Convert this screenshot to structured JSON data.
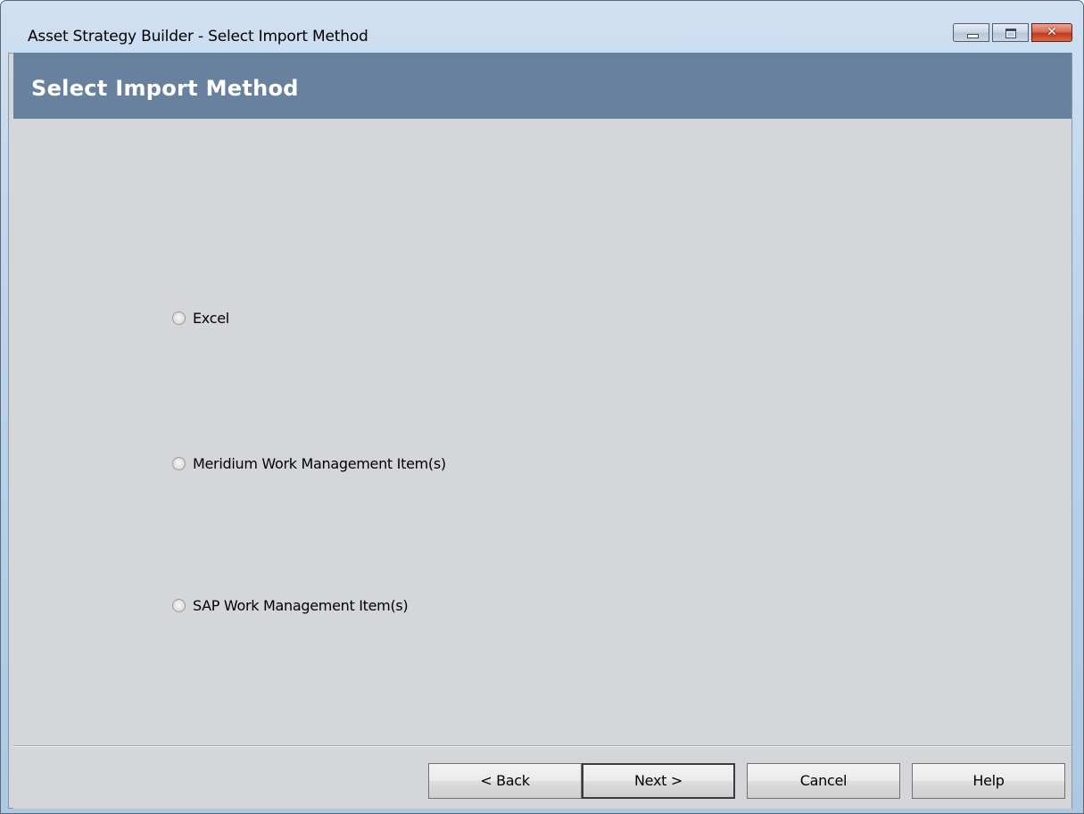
{
  "window": {
    "title": "Asset Strategy Builder - Select Import Method",
    "controls": {
      "minimize_icon": "minimize-icon",
      "maximize_icon": "maximize-icon",
      "close_icon": "close-icon"
    }
  },
  "header": {
    "title": "Select Import Method",
    "background": "#67819e"
  },
  "options": [
    {
      "label": "Excel",
      "selected": false
    },
    {
      "label": "Meridium Work Management Item(s)",
      "selected": false
    },
    {
      "label": "SAP Work Management Item(s)",
      "selected": false
    }
  ],
  "footer": {
    "back_label": "< Back",
    "next_label": "Next >",
    "cancel_label": "Cancel",
    "help_label": "Help"
  }
}
